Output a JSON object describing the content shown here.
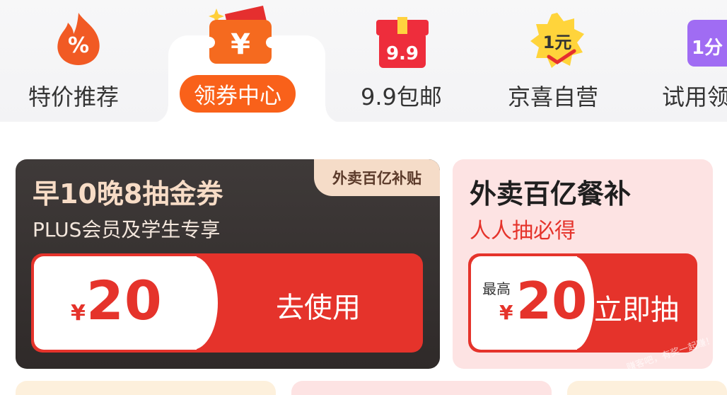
{
  "categories": [
    {
      "label": "特价推荐",
      "icon": "flame-percent-icon",
      "icon_text": "%",
      "active": false
    },
    {
      "label": "领券中心",
      "icon": "coupon-yen-icon",
      "icon_text": "¥",
      "active": true
    },
    {
      "label": "9.9包邮",
      "icon": "gift-box-icon",
      "icon_text": "9.9",
      "active": false
    },
    {
      "label": "京喜自营",
      "icon": "badge-one-yuan-icon",
      "icon_text": "1元",
      "active": false
    },
    {
      "label": "试用领",
      "icon": "trial-bag-icon",
      "icon_text": "1分",
      "active": false
    }
  ],
  "promo_left": {
    "tag": "外卖百亿补贴",
    "title": "早10晚8抽金券",
    "subtitle": "PLUS会员及学生专享",
    "currency": "¥",
    "amount": "20",
    "action": "去使用"
  },
  "promo_right": {
    "title": "外卖百亿餐补",
    "subtitle": "人人抽必得",
    "prefix": "最高",
    "currency": "¥",
    "amount": "20",
    "action": "立即抽"
  },
  "watermark": "赚客吧，有奖一起赚！www.zuanke8.com",
  "colors": {
    "accent_orange": "#f9611a",
    "red": "#e5332b",
    "dark_card": "#3a3534",
    "pink_card": "#fde3e3",
    "gold_text": "#f7dcc6"
  }
}
